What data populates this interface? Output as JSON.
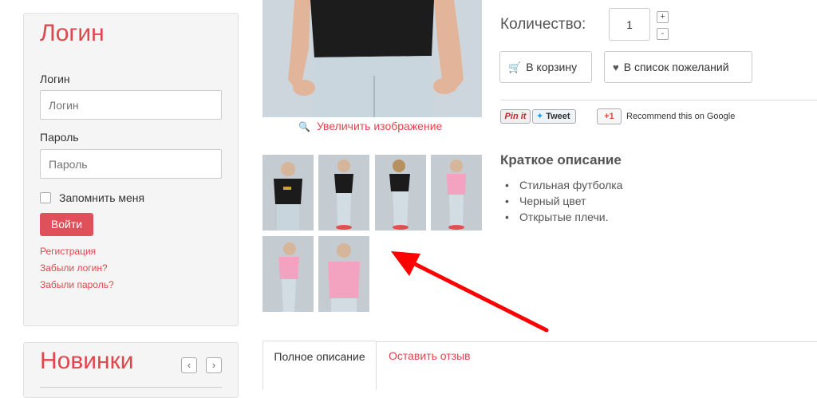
{
  "login_panel": {
    "title": "Логин",
    "username_label": "Логин",
    "username_placeholder": "Логин",
    "password_label": "Пароль",
    "password_placeholder": "Пароль",
    "remember_label": "Запомнить меня",
    "submit_label": "Войти",
    "links": [
      "Регистрация",
      "Забыли логин?",
      "Забыли пароль?"
    ]
  },
  "new_panel": {
    "title": "Новинки",
    "prev_icon": "chevron-left-icon",
    "next_icon": "chevron-right-icon"
  },
  "product": {
    "zoom_label": "Увеличить изображение",
    "quantity_label": "Количество:",
    "quantity_value": "1",
    "increment_label": "+",
    "decrement_label": "-",
    "add_to_cart_label": "В корзину",
    "wishlist_label": "В список пожеланий",
    "share": {
      "pinit_label": "Pin it",
      "tweet_label": "Tweet",
      "gplus_label": "+1",
      "google_text": "Recommend this on Google"
    },
    "short_desc_title": "Краткое описание",
    "short_desc_items": [
      "Стильная футболка",
      "Черный цвет",
      "Открытые плечи."
    ]
  },
  "tabs": [
    "Полное описание",
    "Оставить отзыв"
  ],
  "colors": {
    "accent": "#e0474c",
    "annotation_arrow": "#ff0000"
  }
}
